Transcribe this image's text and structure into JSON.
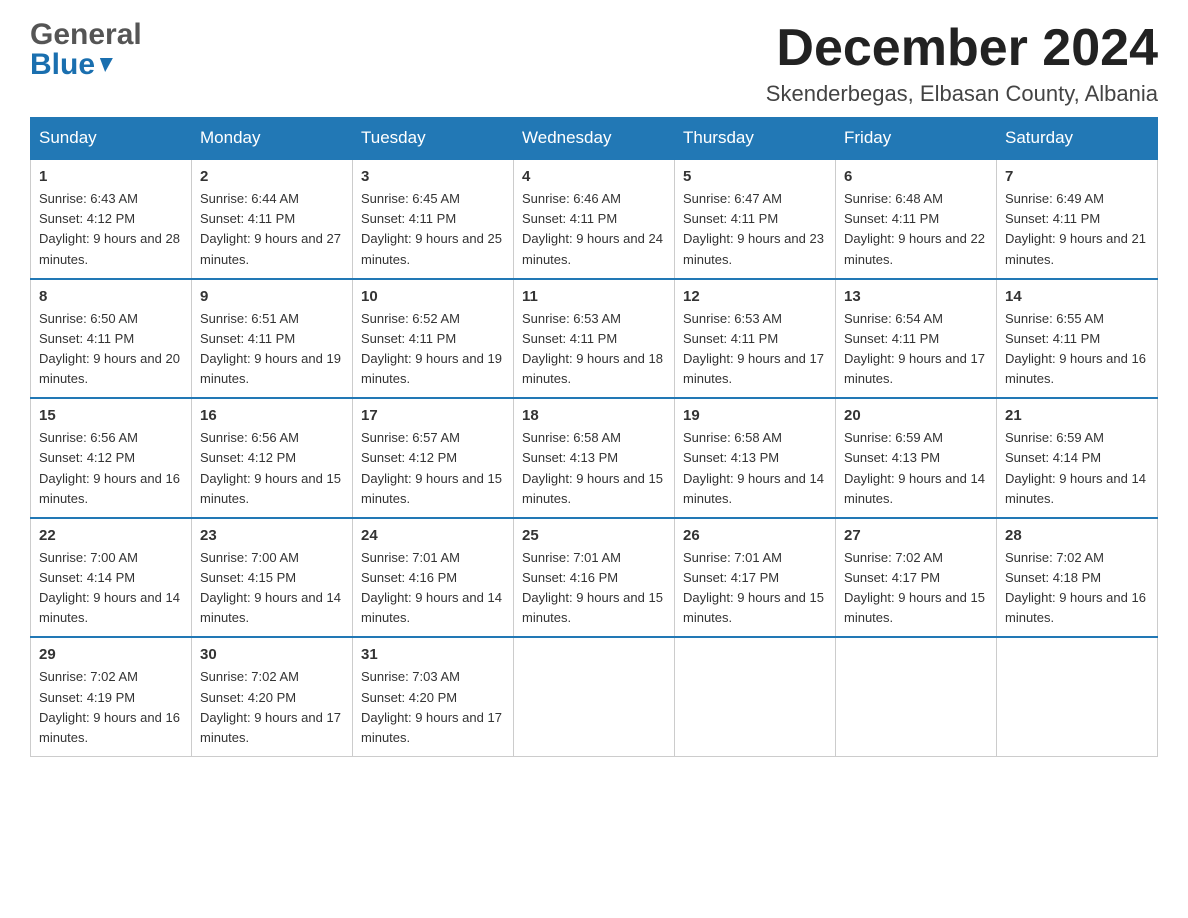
{
  "header": {
    "logo_line1": "General",
    "logo_line2": "Blue",
    "title": "December 2024",
    "subtitle": "Skenderbegas, Elbasan County, Albania"
  },
  "weekdays": [
    "Sunday",
    "Monday",
    "Tuesday",
    "Wednesday",
    "Thursday",
    "Friday",
    "Saturday"
  ],
  "weeks": [
    [
      {
        "day": "1",
        "sunrise": "6:43 AM",
        "sunset": "4:12 PM",
        "daylight": "9 hours and 28 minutes."
      },
      {
        "day": "2",
        "sunrise": "6:44 AM",
        "sunset": "4:11 PM",
        "daylight": "9 hours and 27 minutes."
      },
      {
        "day": "3",
        "sunrise": "6:45 AM",
        "sunset": "4:11 PM",
        "daylight": "9 hours and 25 minutes."
      },
      {
        "day": "4",
        "sunrise": "6:46 AM",
        "sunset": "4:11 PM",
        "daylight": "9 hours and 24 minutes."
      },
      {
        "day": "5",
        "sunrise": "6:47 AM",
        "sunset": "4:11 PM",
        "daylight": "9 hours and 23 minutes."
      },
      {
        "day": "6",
        "sunrise": "6:48 AM",
        "sunset": "4:11 PM",
        "daylight": "9 hours and 22 minutes."
      },
      {
        "day": "7",
        "sunrise": "6:49 AM",
        "sunset": "4:11 PM",
        "daylight": "9 hours and 21 minutes."
      }
    ],
    [
      {
        "day": "8",
        "sunrise": "6:50 AM",
        "sunset": "4:11 PM",
        "daylight": "9 hours and 20 minutes."
      },
      {
        "day": "9",
        "sunrise": "6:51 AM",
        "sunset": "4:11 PM",
        "daylight": "9 hours and 19 minutes."
      },
      {
        "day": "10",
        "sunrise": "6:52 AM",
        "sunset": "4:11 PM",
        "daylight": "9 hours and 19 minutes."
      },
      {
        "day": "11",
        "sunrise": "6:53 AM",
        "sunset": "4:11 PM",
        "daylight": "9 hours and 18 minutes."
      },
      {
        "day": "12",
        "sunrise": "6:53 AM",
        "sunset": "4:11 PM",
        "daylight": "9 hours and 17 minutes."
      },
      {
        "day": "13",
        "sunrise": "6:54 AM",
        "sunset": "4:11 PM",
        "daylight": "9 hours and 17 minutes."
      },
      {
        "day": "14",
        "sunrise": "6:55 AM",
        "sunset": "4:11 PM",
        "daylight": "9 hours and 16 minutes."
      }
    ],
    [
      {
        "day": "15",
        "sunrise": "6:56 AM",
        "sunset": "4:12 PM",
        "daylight": "9 hours and 16 minutes."
      },
      {
        "day": "16",
        "sunrise": "6:56 AM",
        "sunset": "4:12 PM",
        "daylight": "9 hours and 15 minutes."
      },
      {
        "day": "17",
        "sunrise": "6:57 AM",
        "sunset": "4:12 PM",
        "daylight": "9 hours and 15 minutes."
      },
      {
        "day": "18",
        "sunrise": "6:58 AM",
        "sunset": "4:13 PM",
        "daylight": "9 hours and 15 minutes."
      },
      {
        "day": "19",
        "sunrise": "6:58 AM",
        "sunset": "4:13 PM",
        "daylight": "9 hours and 14 minutes."
      },
      {
        "day": "20",
        "sunrise": "6:59 AM",
        "sunset": "4:13 PM",
        "daylight": "9 hours and 14 minutes."
      },
      {
        "day": "21",
        "sunrise": "6:59 AM",
        "sunset": "4:14 PM",
        "daylight": "9 hours and 14 minutes."
      }
    ],
    [
      {
        "day": "22",
        "sunrise": "7:00 AM",
        "sunset": "4:14 PM",
        "daylight": "9 hours and 14 minutes."
      },
      {
        "day": "23",
        "sunrise": "7:00 AM",
        "sunset": "4:15 PM",
        "daylight": "9 hours and 14 minutes."
      },
      {
        "day": "24",
        "sunrise": "7:01 AM",
        "sunset": "4:16 PM",
        "daylight": "9 hours and 14 minutes."
      },
      {
        "day": "25",
        "sunrise": "7:01 AM",
        "sunset": "4:16 PM",
        "daylight": "9 hours and 15 minutes."
      },
      {
        "day": "26",
        "sunrise": "7:01 AM",
        "sunset": "4:17 PM",
        "daylight": "9 hours and 15 minutes."
      },
      {
        "day": "27",
        "sunrise": "7:02 AM",
        "sunset": "4:17 PM",
        "daylight": "9 hours and 15 minutes."
      },
      {
        "day": "28",
        "sunrise": "7:02 AM",
        "sunset": "4:18 PM",
        "daylight": "9 hours and 16 minutes."
      }
    ],
    [
      {
        "day": "29",
        "sunrise": "7:02 AM",
        "sunset": "4:19 PM",
        "daylight": "9 hours and 16 minutes."
      },
      {
        "day": "30",
        "sunrise": "7:02 AM",
        "sunset": "4:20 PM",
        "daylight": "9 hours and 17 minutes."
      },
      {
        "day": "31",
        "sunrise": "7:03 AM",
        "sunset": "4:20 PM",
        "daylight": "9 hours and 17 minutes."
      },
      null,
      null,
      null,
      null
    ]
  ]
}
